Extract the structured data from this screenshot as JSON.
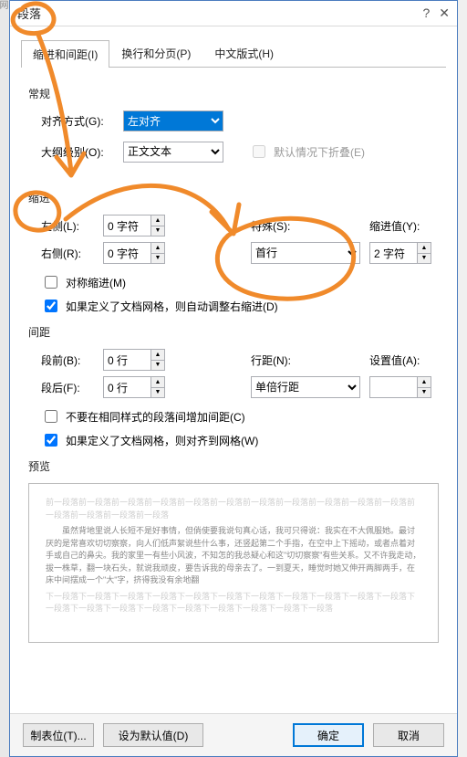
{
  "titlebar": {
    "title": "段落"
  },
  "tabs": [
    {
      "label": "缩进和间距(I)"
    },
    {
      "label": "换行和分页(P)"
    },
    {
      "label": "中文版式(H)"
    }
  ],
  "sections": {
    "general": "常规",
    "indent": "缩进",
    "spacing": "间距",
    "preview": "预览"
  },
  "general": {
    "align_label": "对齐方式(G):",
    "align_value": "左对齐",
    "outline_label": "大纲级别(O):",
    "outline_value": "正文文本",
    "collapse_label": "默认情况下折叠(E)"
  },
  "indent": {
    "left_label": "左侧(L):",
    "left_value": "0 字符",
    "right_label": "右侧(R):",
    "right_value": "0 字符",
    "special_label": "特殊(S):",
    "special_value": "首行",
    "by_label": "缩进值(Y):",
    "by_value": "2 字符",
    "mirror_label": "对称缩进(M)",
    "grid_label": "如果定义了文档网格，则自动调整右缩进(D)"
  },
  "spacing": {
    "before_label": "段前(B):",
    "before_value": "0 行",
    "after_label": "段后(F):",
    "after_value": "0 行",
    "line_label": "行距(N):",
    "line_value": "单倍行距",
    "at_label": "设置值(A):",
    "at_value": "",
    "nospace_label": "不要在相同样式的段落间增加间距(C)",
    "snap_label": "如果定义了文档网格，则对齐到网格(W)"
  },
  "preview": {
    "ghost_before": "前一段落前一段落前一段落前一段落前一段落前一段落前一段落前一段落前一段落前一段落前一段落前一段落前一段落前一段落前一段落",
    "sample": "虽然背地里说人长短不是好事情，但倘使要我说句真心话，我可只得说：我实在不大佩服她。最讨厌的是常喜欢切切察察，向人们低声絮说些什么事，还竖起第二个手指，在空中上下摇动，或者点着对手或自己的鼻尖。我的家里一有些小风波，不知怎的我总疑心和这\"切切察察\"有些关系。又不许我走动，拔一株草，翻一块石头，就说我顽皮，要告诉我的母亲去了。一到夏天，睡觉时她又伸开两脚两手，在床中间摆成一个\"大\"字，挤得我没有余地翻",
    "ghost_after": "下一段落下一段落下一段落下一段落下一段落下一段落下一段落下一段落下一段落下一段落下一段落下一段落下一段落下一段落下一段落下一段落下一段落下一段落下一段落下一段落"
  },
  "footer": {
    "tabs": "制表位(T)...",
    "default": "设为默认值(D)",
    "ok": "确定",
    "cancel": "取消"
  }
}
